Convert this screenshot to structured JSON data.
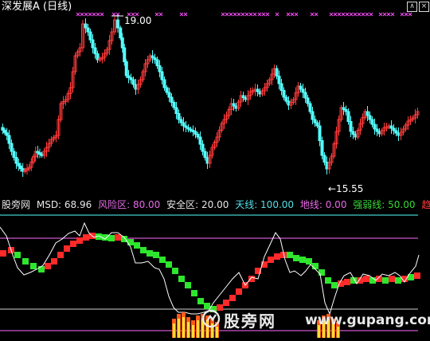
{
  "header": {
    "title": "深发展A (日线)",
    "buttons": [
      {
        "name": "up-button",
        "glyph": "∧"
      },
      {
        "name": "close-button",
        "glyph": "×"
      }
    ]
  },
  "price_panel": {
    "high_label": "19.00",
    "low_label": "←15.55"
  },
  "indicator": {
    "name": "股旁网",
    "items": [
      {
        "label": "MSD: 68.96",
        "color": "#e6e6e6"
      },
      {
        "label": "风险区: 80.00",
        "color": "#e86ae8"
      },
      {
        "label": "安全区: 20.00",
        "color": "#e6e6e6"
      },
      {
        "label": "天线: 100.00",
        "color": "#53e0e8"
      },
      {
        "label": "地线: 0.00",
        "color": "#e86ae8"
      },
      {
        "label": "强弱线: 50.00",
        "color": "#36d936"
      },
      {
        "label": "趋势信",
        "color": "#ff3b3b"
      }
    ]
  },
  "watermark": {
    "cn": "股旁网",
    "url": "www.gupang.com"
  },
  "colors": {
    "up_candle": "#ff3a3a",
    "down_candle": "#54ffff",
    "marker": "#ff4cff",
    "msd_line": "#ffffff",
    "risk_line": "#ff6cff",
    "safe_line": "#cfcfcf",
    "bull_block": "#ff2a2a",
    "bear_block": "#2ee62e"
  }
}
